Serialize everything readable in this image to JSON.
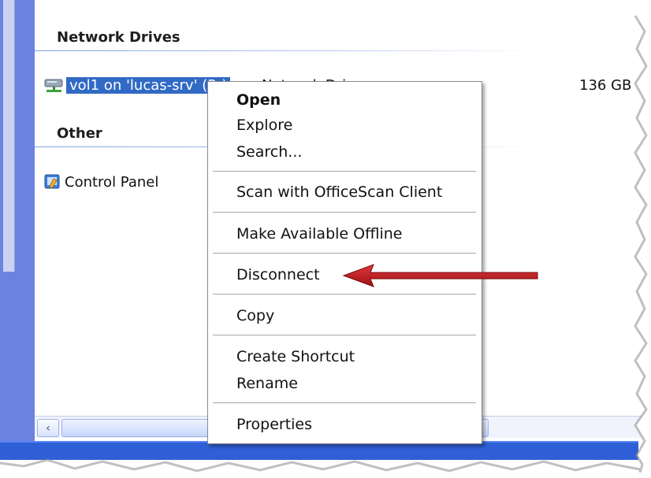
{
  "sections": {
    "network_drives": {
      "title": "Network Drives",
      "item": {
        "label": "vol1 on 'lucas-srv' (R:)",
        "type": "Network Drive",
        "size": "136 GB"
      }
    },
    "other": {
      "title": "Other",
      "item": {
        "label": "Control Panel"
      }
    }
  },
  "context_menu": {
    "items": [
      {
        "label": "Open"
      },
      {
        "label": "Explore"
      },
      {
        "label": "Search..."
      },
      {
        "label": "Scan with OfficeScan Client"
      },
      {
        "label": "Make Available Offline"
      },
      {
        "label": "Disconnect"
      },
      {
        "label": "Copy"
      },
      {
        "label": "Create Shortcut"
      },
      {
        "label": "Rename"
      },
      {
        "label": "Properties"
      }
    ]
  },
  "scrollbar": {
    "left_arrow": "‹"
  },
  "colors": {
    "selection": "#316ac5",
    "annotation_arrow": "#c0161b",
    "task_pane": "#6b83e0",
    "taskbar": "#2f5fd6"
  }
}
